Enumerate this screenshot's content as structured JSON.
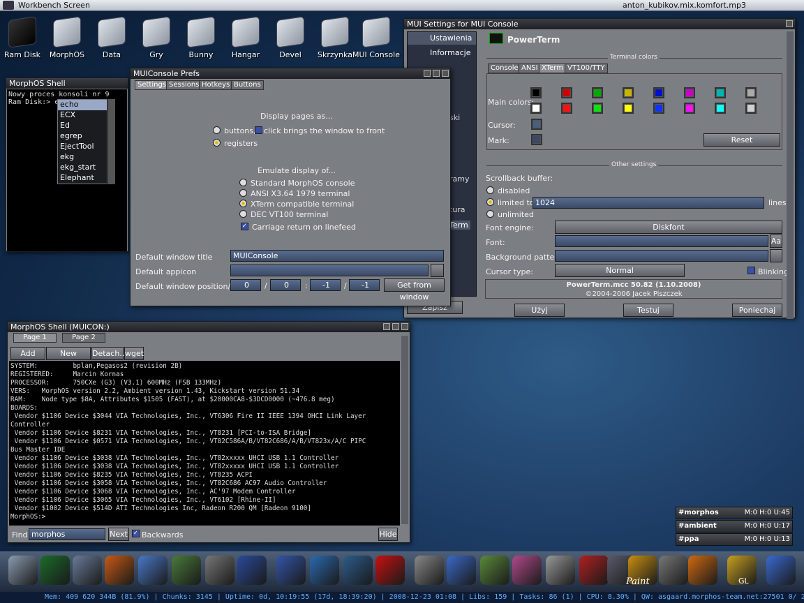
{
  "screen": {
    "title": "Workbench Screen",
    "song": "anton_kubikov.mix.komfort.mp3"
  },
  "desktop_icons": [
    "Ram Disk",
    "MorphOS",
    "Data",
    "Gry",
    "Bunny",
    "Hangar",
    "Devel",
    "Skrzynka",
    "MUI Console"
  ],
  "shell1": {
    "title": "MorphOS Shell",
    "lines": [
      "Nowy proces konsoli nr 9",
      "Ram Disk:> e"
    ],
    "completion": [
      "echo",
      "ECX",
      "Ed",
      "egrep",
      "EjectTool",
      "ekg",
      "ekg_start",
      "Elephant"
    ]
  },
  "prefs": {
    "title": "MUIConsole Prefs",
    "tabs": [
      "Settings",
      "Sessions",
      "Hotkeys",
      "Buttons"
    ],
    "display_pages": "Display pages as...",
    "opt_buttons": "buttons,",
    "click_front": "click brings the window to front",
    "opt_registers": "registers",
    "emulate": "Emulate display of...",
    "emul": [
      "Standard MorphOS console",
      "ANSI X3.64 1979 terminal",
      "XTerm compatible terminal",
      "DEC VT100 terminal"
    ],
    "cr": "Carriage return on linefeed",
    "def_title_lbl": "Default window title",
    "def_title_val": "MUIConsole",
    "def_appicon_lbl": "Default appicon",
    "def_pos_lbl": "Default window position/size",
    "pos": [
      "0",
      "0",
      "-1",
      "-1"
    ],
    "get_btn": "Get from window"
  },
  "mui": {
    "title": "MUI Settings for MUI Console",
    "side_top": "Ustawienia",
    "side_info": "Informacje",
    "side_frag": [
      "ski",
      "ramy",
      "tura",
      "Term"
    ],
    "side_zapisz": "Zapisz",
    "header": "PowerTerm",
    "terminal_colors": "Terminal colors",
    "tabs": [
      "Console",
      "ANSI",
      "XTerm",
      "VT100/TTY"
    ],
    "main_colors": "Main colors:",
    "cursor": "Cursor:",
    "mark": "Mark:",
    "reset": "Reset",
    "row1": [
      "#000000",
      "#cc0000",
      "#00aa00",
      "#c8b400",
      "#0010c8",
      "#c800c8",
      "#00b4b4",
      "#aaaaaa"
    ],
    "row2": [
      "#ffffff",
      "#ff1010",
      "#10e010",
      "#ffff10",
      "#1030ff",
      "#ff10ff",
      "#10ffff",
      "#d0d0d0"
    ],
    "other": "Other settings",
    "scrollback": "Scrollback buffer:",
    "disabled": "disabled",
    "limited": "limited to",
    "limit_val": "1024",
    "lines": "lines",
    "unlimited": "unlimited",
    "font_engine": "Font engine:",
    "font_engine_val": "Diskfont",
    "font": "Font:",
    "bg": "Background pattern:",
    "cursor_type": "Cursor type:",
    "cursor_type_val": "Normal",
    "blinking": "Blinking",
    "about1": "PowerTerm.mcc 50.82 (1.10.2008)",
    "about2": "©2004-2006 Jacek Piszczek",
    "btn_save": "Użyj",
    "btn_test": "Testuj",
    "btn_cancel": "Poniechaj"
  },
  "shell2": {
    "title": "MorphOS Shell (MUICON:)",
    "pages": [
      "Page 1",
      "Page 2"
    ],
    "buttons": [
      "Add page",
      "New window",
      "Detach...",
      "wget"
    ],
    "lines": [
      "SYSTEM:         bplan,Pegasos2 (revision 2B)",
      "REGISTERED:     Marcin Kornas",
      "PROCESSOR:      750CXe (G3) (V3.1) 600MHz (FSB 133MHz)",
      "VERS:   MorphOS version 2.2, Ambient version 1.43, Kickstart version 51.34",
      "RAM:    Node type $8A, Attributes $1505 (FAST), at $20000CA8-$3DCD0000 (~476.8 meg)",
      "BOARDS:",
      " Vendor $1106 Device $3044 VIA Technologies, Inc., VT6306 Fire II IEEE 1394 OHCI Link Layer",
      "Controller",
      " Vendor $1106 Device $8231 VIA Technologies, Inc., VT8231 [PCI-to-ISA Bridge]",
      " Vendor $1106 Device $0571 VIA Technologies, Inc., VT82C586A/B/VT82C686/A/B/VT823x/A/C PIPC",
      "Bus Master IDE",
      " Vendor $1106 Device $3038 VIA Technologies, Inc., VT82xxxxx UHCI USB 1.1 Controller",
      " Vendor $1106 Device $3038 VIA Technologies, Inc., VT82xxxxx UHCI USB 1.1 Controller",
      " Vendor $1106 Device $8235 VIA Technologies, Inc., VT8235 ACPI",
      " Vendor $1106 Device $3058 VIA Technologies, Inc., VT82C686 AC97 Audio Controller",
      " Vendor $1106 Device $3068 VIA Technologies, Inc., AC'97 Modem Controller",
      " Vendor $1106 Device $3065 VIA Technologies, Inc., VT6102 [Rhine-II]",
      " Vendor $1002 Device $514D ATI Technologies Inc, Radeon R200 QM [Radeon 9100]",
      "MorphOS:>"
    ],
    "find_lbl": "Find",
    "find_val": "morphos",
    "next": "Next",
    "backwards": "Backwards",
    "hide": "Hide"
  },
  "irc": [
    {
      "ch": "#morphos",
      "st": "M:0 H:0 U:45"
    },
    {
      "ch": "#ambient",
      "st": "M:0 H:0 U:17"
    },
    {
      "ch": "#ppa",
      "st": "M:0 H:0 U:13"
    }
  ],
  "dock_labels": [
    "Paint",
    "GL"
  ],
  "status": "Mem: 409 620 344B (81.9%) | Chunks: 3145 | Uptime: 0d, 10:19:55 (17d, 18:39:20) | 2008-12-23 01:08 | Libs: 159 | Tasks: 86 (1) | CPU: 8.30% | QW: asgaard.morphos-team.net:27501  0/ 2   ztndm3    50 / 0"
}
